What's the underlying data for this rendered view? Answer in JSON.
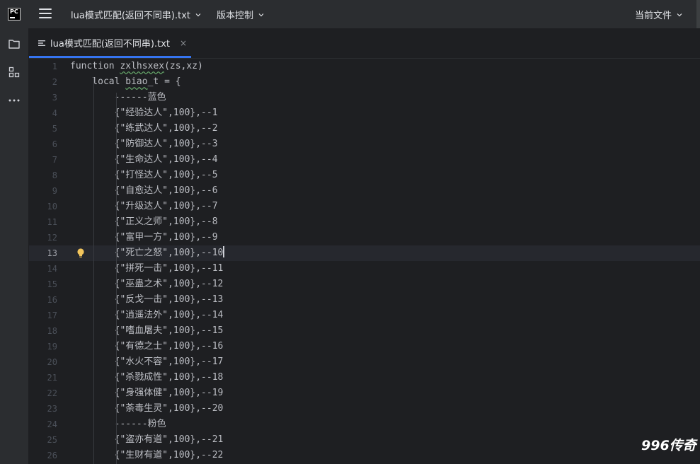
{
  "titlebar": {
    "logo_text": "PC",
    "project_label": "lua模式匹配(返回不同串).txt",
    "vcs_label": "版本控制",
    "run_config_label": "当前文件"
  },
  "icons": {
    "app_logo": "pycharm-logo-icon",
    "main_menu": "hamburger-menu-icon",
    "project_tool": "folder-icon",
    "structure_tool": "structure-icon",
    "more_tools": "more-horizontal-icon",
    "tab_file": "text-file-icon",
    "close": "close-icon",
    "intention": "lightbulb-icon"
  },
  "tab": {
    "label": "lua模式匹配(返回不同串).txt",
    "close_glyph": "×"
  },
  "editor": {
    "lines": [
      {
        "n": "1",
        "text": "function zxlhsxex(zs,xz)"
      },
      {
        "n": "2",
        "text": "    local biao_t = {"
      },
      {
        "n": "3",
        "text": "        ------蓝色"
      },
      {
        "n": "4",
        "text": "        {\"经验达人\",100},--1"
      },
      {
        "n": "5",
        "text": "        {\"练武达人\",100},--2"
      },
      {
        "n": "6",
        "text": "        {\"防御达人\",100},--3"
      },
      {
        "n": "7",
        "text": "        {\"生命达人\",100},--4"
      },
      {
        "n": "8",
        "text": "        {\"打怪达人\",100},--5"
      },
      {
        "n": "9",
        "text": "        {\"自愈达人\",100},--6"
      },
      {
        "n": "10",
        "text": "        {\"升级达人\",100},--7"
      },
      {
        "n": "11",
        "text": "        {\"正义之师\",100},--8"
      },
      {
        "n": "12",
        "text": "        {\"富甲一方\",100},--9"
      },
      {
        "n": "13",
        "text": "        {\"死亡之怒\",100},--10"
      },
      {
        "n": "14",
        "text": "        {\"拼死一击\",100},--11"
      },
      {
        "n": "15",
        "text": "        {\"巫蛊之术\",100},--12"
      },
      {
        "n": "16",
        "text": "        {\"反戈一击\",100},--13"
      },
      {
        "n": "17",
        "text": "        {\"逍遥法外\",100},--14"
      },
      {
        "n": "18",
        "text": "        {\"嗜血屠夫\",100},--15"
      },
      {
        "n": "19",
        "text": "        {\"有德之士\",100},--16"
      },
      {
        "n": "20",
        "text": "        {\"水火不容\",100},--17"
      },
      {
        "n": "21",
        "text": "        {\"杀戮成性\",100},--18"
      },
      {
        "n": "22",
        "text": "        {\"身强体健\",100},--19"
      },
      {
        "n": "23",
        "text": "        {\"荼毒生灵\",100},--20"
      },
      {
        "n": "24",
        "text": "        ------粉色"
      },
      {
        "n": "25",
        "text": "        {\"盗亦有道\",100},--21"
      },
      {
        "n": "26",
        "text": "        {\"生财有道\",100},--22"
      }
    ],
    "current_line": "13"
  },
  "watermark": "996传奇"
}
